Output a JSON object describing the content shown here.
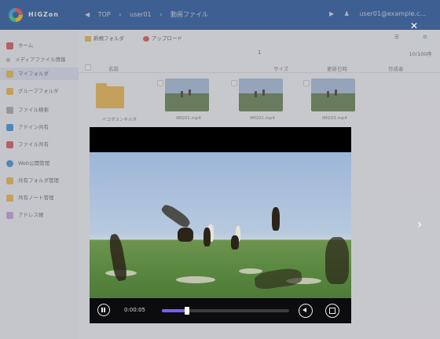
{
  "topbar": {
    "brand": "HiGZon",
    "breadcrumbs": [
      "TOP",
      "user01",
      "動画ファイル"
    ],
    "user_email": "user01@example.c..."
  },
  "sidebar": {
    "items": [
      {
        "label": "ホーム",
        "icon": "home-icon",
        "color": "#d9534f"
      },
      {
        "label": "メディアファイル情報",
        "icon": "info-icon",
        "color": "#999999"
      },
      {
        "label": "マイフォルダ",
        "icon": "folder-icon",
        "color": "#f1b944",
        "active": true
      },
      {
        "label": "グループフォルダ",
        "icon": "group-folder-icon",
        "color": "#f1b944"
      },
      {
        "label": "ファイル検索",
        "icon": "search-file-icon",
        "color": "#888888"
      },
      {
        "label": "アドイン共有",
        "icon": "send-icon",
        "color": "#3a8fd8"
      },
      {
        "label": "ファイル共有",
        "icon": "share-icon",
        "color": "#d9534f"
      },
      {
        "label": "Web公開管理",
        "icon": "globe-icon",
        "color": "#3a8fd8"
      },
      {
        "label": "共有フォルダ管理",
        "icon": "shared-folder-icon",
        "color": "#f1b944"
      },
      {
        "label": "共有ノート管理",
        "icon": "note-icon",
        "color": "#f1b944"
      },
      {
        "label": "アドレス帳",
        "icon": "addressbook-icon",
        "color": "#c9a0dc"
      }
    ]
  },
  "toolbar": {
    "new_folder": "新規フォルダ",
    "upload": "アップロード"
  },
  "pagination": {
    "page": "1",
    "per_page": "10/100件"
  },
  "columns": {
    "name": "名前",
    "size": "サイズ",
    "updated": "更新日時",
    "created": "作成者"
  },
  "files": [
    {
      "name": "ペコダスンキルダ",
      "type": "folder"
    },
    {
      "name": "IMG01.mp4",
      "type": "video"
    },
    {
      "name": "IMG02.mp4",
      "type": "video"
    },
    {
      "name": "IMG03.mp4",
      "type": "video"
    }
  ],
  "player": {
    "time": "0:00:05",
    "progress": 0.2,
    "accent": "#7c5cff"
  }
}
